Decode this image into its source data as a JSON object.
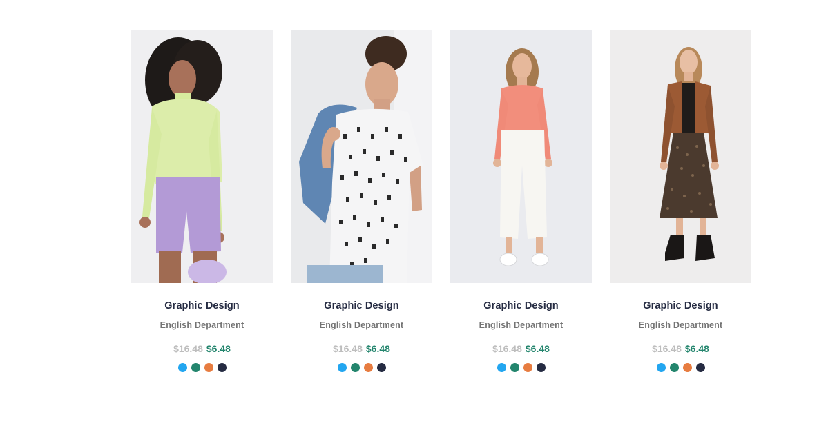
{
  "products": [
    {
      "title": "Graphic Design",
      "department": "English Department",
      "old_price": "$16.48",
      "new_price": "$6.48",
      "image": "woman-green-turtleneck-lilac-shorts",
      "swatches": [
        "#23a6f0",
        "#23856d",
        "#e77c40",
        "#252b42"
      ]
    },
    {
      "title": "Graphic Design",
      "department": "English Department",
      "old_price": "$16.48",
      "new_price": "$6.48",
      "image": "man-letter-print-tshirt-denim-jacket",
      "swatches": [
        "#23a6f0",
        "#23856d",
        "#e77c40",
        "#252b42"
      ]
    },
    {
      "title": "Graphic Design",
      "department": "English Department",
      "old_price": "$16.48",
      "new_price": "$6.48",
      "image": "woman-coral-top-white-jeans",
      "swatches": [
        "#23a6f0",
        "#23856d",
        "#e77c40",
        "#252b42"
      ]
    },
    {
      "title": "Graphic Design",
      "department": "English Department",
      "old_price": "$16.48",
      "new_price": "$6.48",
      "image": "woman-brown-jacket-floral-skirt",
      "swatches": [
        "#23a6f0",
        "#23856d",
        "#e77c40",
        "#252b42"
      ]
    }
  ],
  "colors": {
    "title": "#252b42",
    "department": "#737373",
    "old_price": "#bdbdbd",
    "new_price": "#23856d"
  }
}
